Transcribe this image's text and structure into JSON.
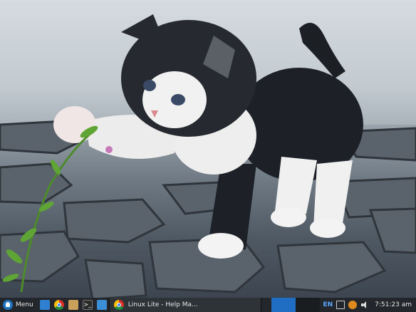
{
  "taskbar": {
    "menu_label": "Menu",
    "launchers": [
      {
        "name": "show-desktop-icon"
      },
      {
        "name": "chrome-icon"
      },
      {
        "name": "file-manager-icon"
      },
      {
        "name": "terminal-icon"
      },
      {
        "name": "calculator-icon"
      }
    ],
    "task_label": "Linux Lite - Help Ma...",
    "tray": {
      "language": "EN",
      "clock": "7:51:23 am"
    }
  },
  "colors": {
    "taskbar_bg": "#23272b",
    "accent": "#1f6ec4"
  }
}
